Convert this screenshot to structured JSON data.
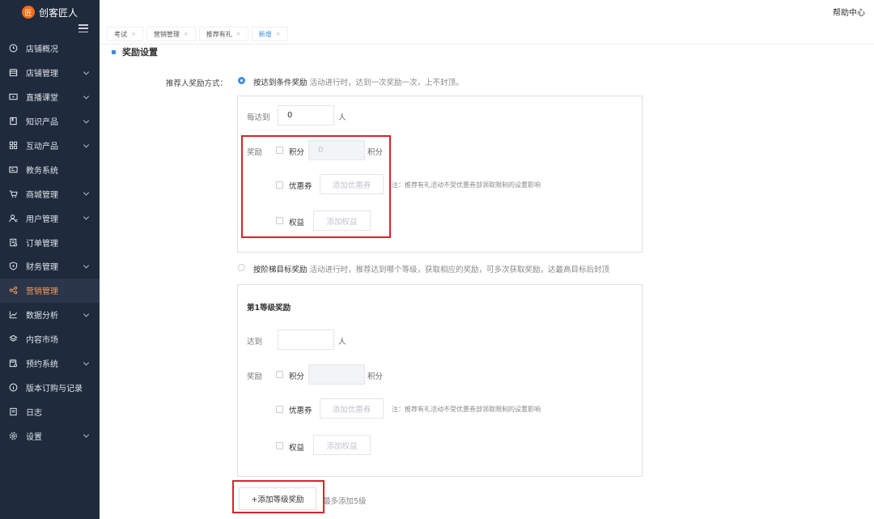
{
  "brand": {
    "logo_char": "匠",
    "name": "创客匠人"
  },
  "topbar": {
    "help": "帮助中心"
  },
  "tabs": [
    {
      "label": "考试",
      "close": "×"
    },
    {
      "label": "营销管理",
      "close": "×"
    },
    {
      "label": "推荐有礼",
      "close": "×"
    },
    {
      "label": "新增",
      "close": "×"
    }
  ],
  "sidebar": {
    "items": [
      {
        "label": "店铺概况",
        "icon": "clock-icon"
      },
      {
        "label": "店铺管理",
        "icon": "store-icon"
      },
      {
        "label": "直播课堂",
        "icon": "video-icon"
      },
      {
        "label": "知识产品",
        "icon": "book-icon"
      },
      {
        "label": "互动产品",
        "icon": "grid-icon"
      },
      {
        "label": "教务系统",
        "icon": "card-icon"
      },
      {
        "label": "商城管理",
        "icon": "cart-icon"
      },
      {
        "label": "用户管理",
        "icon": "user-icon"
      },
      {
        "label": "订单管理",
        "icon": "order-icon"
      },
      {
        "label": "财务管理",
        "icon": "shield-icon"
      },
      {
        "label": "营销管理",
        "icon": "share-icon"
      },
      {
        "label": "数据分析",
        "icon": "chart-icon"
      },
      {
        "label": "内容市场",
        "icon": "layers-icon"
      },
      {
        "label": "预约系统",
        "icon": "calendar-icon"
      },
      {
        "label": "版本订购与记录",
        "icon": "info-icon"
      },
      {
        "label": "日志",
        "icon": "doc-icon"
      },
      {
        "label": "设置",
        "icon": "gear-icon"
      }
    ],
    "active": "营销管理"
  },
  "content": {
    "section_title": "奖励设置",
    "reward_mode_label": "推荐人奖励方式：",
    "option1": {
      "title": "按达到条件奖励",
      "desc": "活动进行时，达到一次奖励一次，上不封顶。"
    },
    "box1": {
      "reach_label": "每达到",
      "reach_value": "0",
      "reach_unit": "人",
      "reward_label": "奖励",
      "points_label": "积分",
      "points_value": "0",
      "points_unit": "积分",
      "coupon_label": "优惠券",
      "coupon_btn": "添加优惠券",
      "coupon_note": "注：推荐有礼活动不受优惠券部领取限制的设置影响",
      "rights_label": "权益",
      "rights_btn": "添加权益"
    },
    "option2": {
      "title": "按阶梯目标奖励",
      "desc": "活动进行时，推荐达到哪个等级，获取相应的奖励，可多次获取奖励，达最高目标后封顶"
    },
    "box2": {
      "level_title": "第1等级奖励",
      "reach_label": "达到",
      "reach_value": "",
      "reach_unit": "人",
      "reward_label": "奖励",
      "points_label": "积分",
      "points_value": "",
      "points_unit": "积分",
      "coupon_label": "优惠券",
      "coupon_btn": "添加优惠券",
      "coupon_note": "注：推荐有礼活动不受优惠券部领取限制的设置影响",
      "rights_label": "权益",
      "rights_btn": "添加权益"
    },
    "add_level_btn": "+添加等级奖励",
    "add_level_hint": "最多添加5级"
  },
  "colors": {
    "sidebar_bg": "#1f2a3d",
    "accent": "#3a8ee6",
    "active_menu": "#f59a5c",
    "highlight": "#d9232e"
  }
}
